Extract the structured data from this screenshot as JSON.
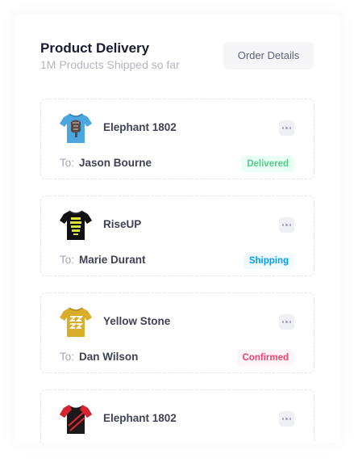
{
  "header": {
    "title": "Product Delivery",
    "subtitle": "1M Products Shipped so far",
    "button_label": "Order Details"
  },
  "to_label": "To:",
  "orders": [
    {
      "product": "Elephant 1802",
      "recipient": "Jason Bourne",
      "status": "Delivered",
      "status_color": "#50cd89",
      "status_bg": "#e8fff3",
      "shirt_icon": "blue-tshirt-elephant-print"
    },
    {
      "product": "RiseUP",
      "recipient": "Marie Durant",
      "status": "Shipping",
      "status_color": "#009ef7",
      "status_bg": "#f1faff",
      "shirt_icon": "black-tshirt-riseup-print"
    },
    {
      "product": "Yellow Stone",
      "recipient": "Dan Wilson",
      "status": "Confirmed",
      "status_color": "#f1416c",
      "status_bg": "#fff5f8",
      "shirt_icon": "yellow-tshirt-print"
    },
    {
      "product": "Elephant 1802",
      "shirt_icon": "red-black-sport-jersey"
    }
  ]
}
